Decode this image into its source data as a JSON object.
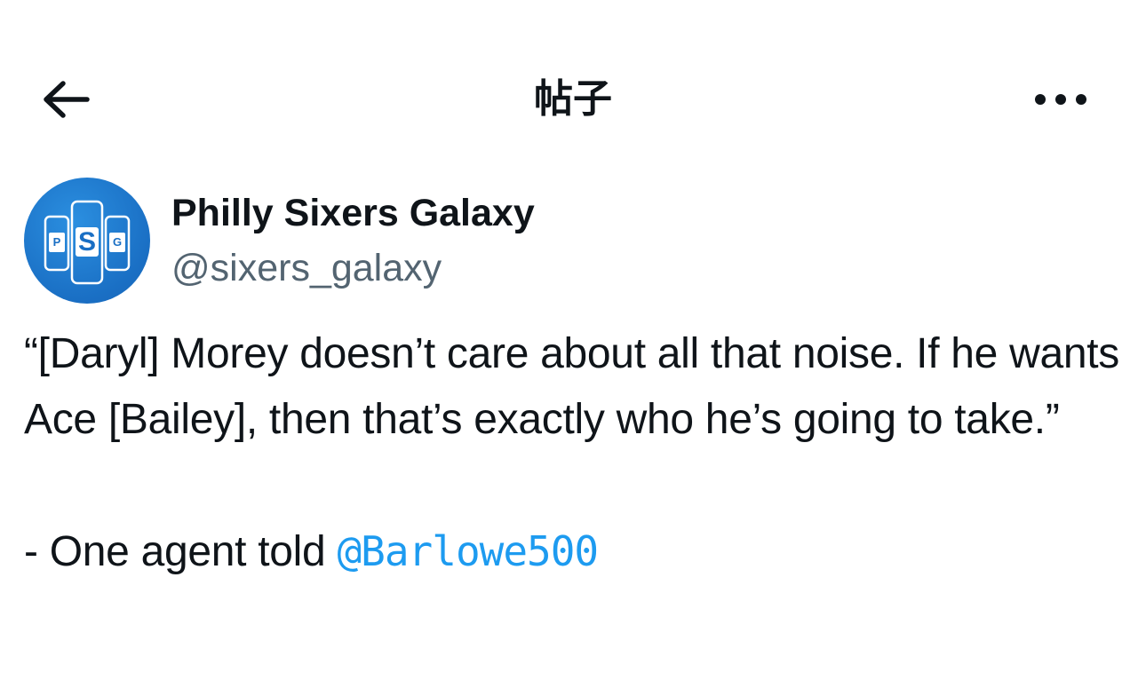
{
  "header": {
    "title": "帖子",
    "back_icon": "arrow-left-icon",
    "more_icon": "more-horizontal-icon"
  },
  "author": {
    "name": "Philly Sixers Galaxy",
    "handle": "@sixers_galaxy",
    "avatar": {
      "letters": [
        "P",
        "S",
        "G"
      ],
      "color": "#1a6fc4"
    }
  },
  "post": {
    "quote": "“[Daryl] Morey doesn’t care about all that noise. If he wants Ace [Bailey], then that’s exactly who he’s going to take.”",
    "attribution_prefix": "- One agent told ",
    "mention": "@Barlowe500"
  },
  "colors": {
    "text": "#0f1419",
    "secondary": "#536471",
    "link": "#1d9bf0"
  }
}
